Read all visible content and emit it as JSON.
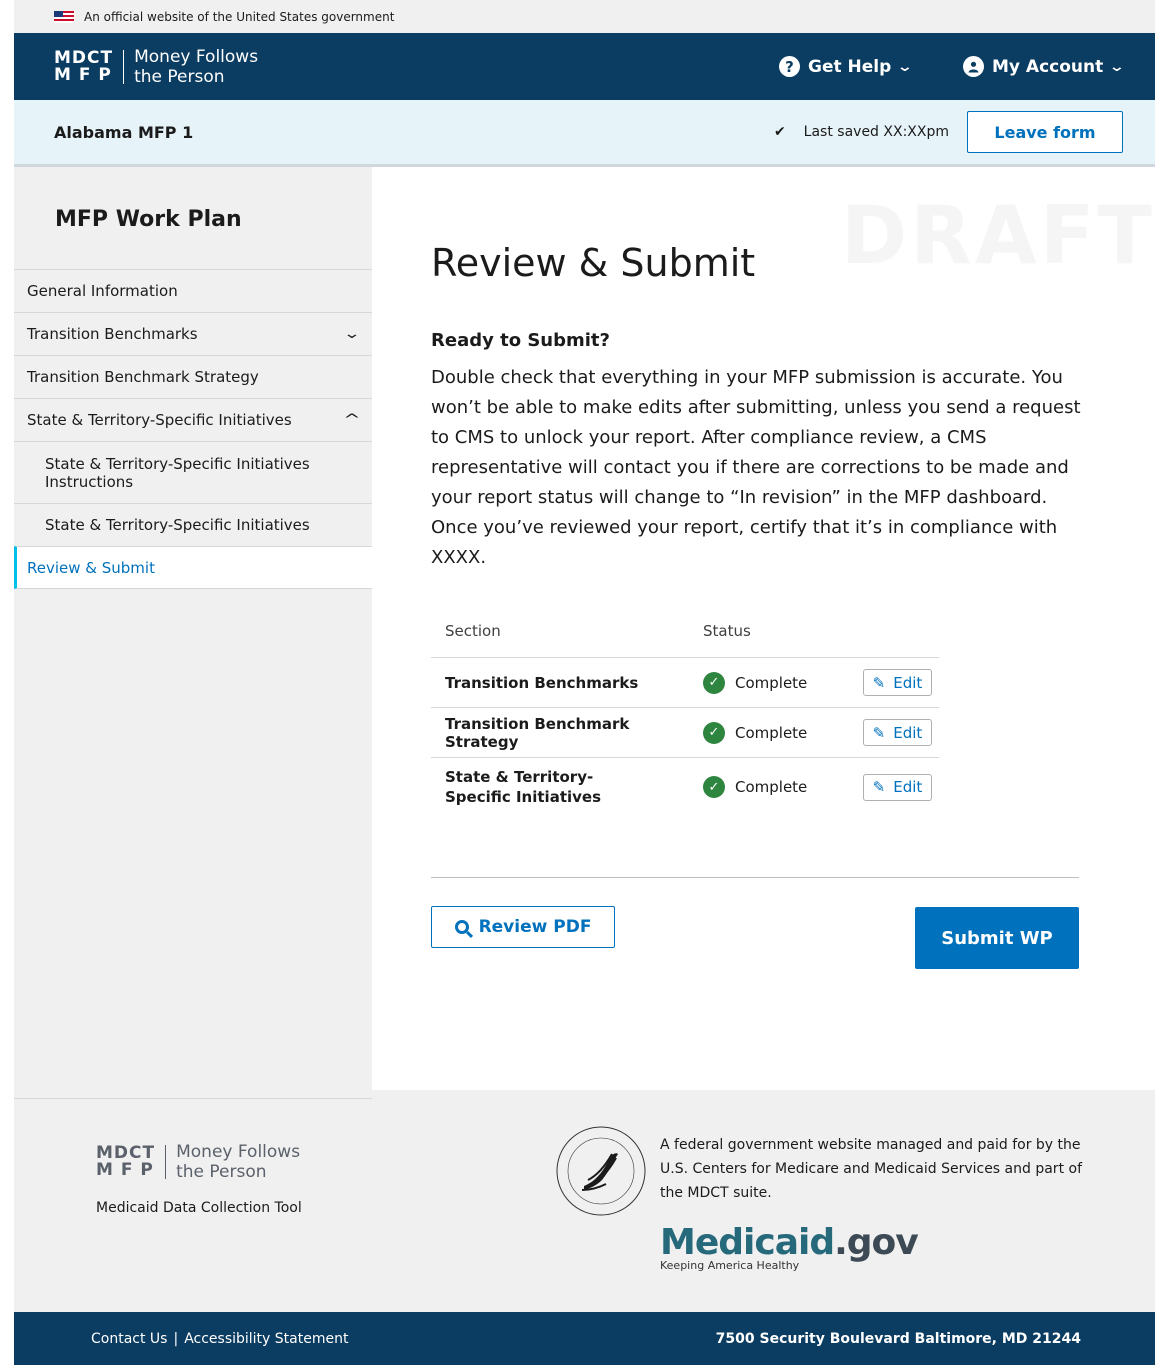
{
  "gov_banner": {
    "text": "An official website of the United States government"
  },
  "header": {
    "logo_mark_top": "MDCT",
    "logo_mark_bottom": "M F P",
    "logo_text_top": "Money Follows",
    "logo_text_bottom": "the Person",
    "help_label": "Get Help",
    "account_label": "My Account"
  },
  "subheader": {
    "report_name": "Alabama MFP 1",
    "last_saved": "Last saved XX:XXpm",
    "leave_label": "Leave form"
  },
  "sidebar": {
    "title": "MFP Work Plan",
    "items": [
      {
        "label": "General Information"
      },
      {
        "label": "Transition Benchmarks"
      },
      {
        "label": "Transition Benchmark Strategy"
      },
      {
        "label": "State & Territory-Specific Initiatives"
      },
      {
        "label": "State & Territory-Specific Initiatives Instructions"
      },
      {
        "label": "State & Territory-Specific Initiatives"
      },
      {
        "label": "Review & Submit"
      }
    ]
  },
  "main": {
    "watermark": "DRAFT",
    "title": "Review & Submit",
    "ready_title": "Ready to Submit?",
    "intro": "Double check that everything in your MFP submission is accurate. You won’t be able to make edits after submitting, unless you send a request to CMS to unlock your report. After compliance review, a CMS representative will contact you if there are corrections to be made and your report status will change to “In revision” in the MFP dashboard. Once you’ve reviewed your report, certify that it’s in compliance with XXXX.",
    "table": {
      "headers": [
        "Section",
        "Status"
      ],
      "rows": [
        {
          "section": "Transition Benchmarks",
          "status": "Complete",
          "edit": "Edit"
        },
        {
          "section": "Transition Benchmark Strategy",
          "status": "Complete",
          "edit": "Edit"
        },
        {
          "section": "State & Territory-Specific Initiatives",
          "status": "Complete",
          "edit": "Edit"
        }
      ]
    },
    "review_pdf_label": "Review PDF",
    "submit_label": "Submit WP"
  },
  "footer": {
    "logo_mark_top": "MDCT",
    "logo_mark_bottom": "M F P",
    "logo_text_top": "Money Follows",
    "logo_text_bottom": "the Person",
    "tool_name": "Medicaid Data Collection Tool",
    "description": "A federal government website managed and paid for by the U.S. Centers for Medicare and Medicaid Services and part of the MDCT suite.",
    "medicaid_brand": "Medicaid",
    "medicaid_suffix": ".gov",
    "medicaid_tagline": "Keeping America Healthy",
    "contact_label": "Contact Us",
    "link_separator": "|",
    "accessibility_label": "Accessibility Statement",
    "address": "7500 Security Boulevard Baltimore, MD 21244"
  },
  "colors": {
    "header_bg": "#0b3c61",
    "accent": "#0071bc",
    "complete": "#2e8540",
    "subheader_bg": "#e6f3f9"
  }
}
